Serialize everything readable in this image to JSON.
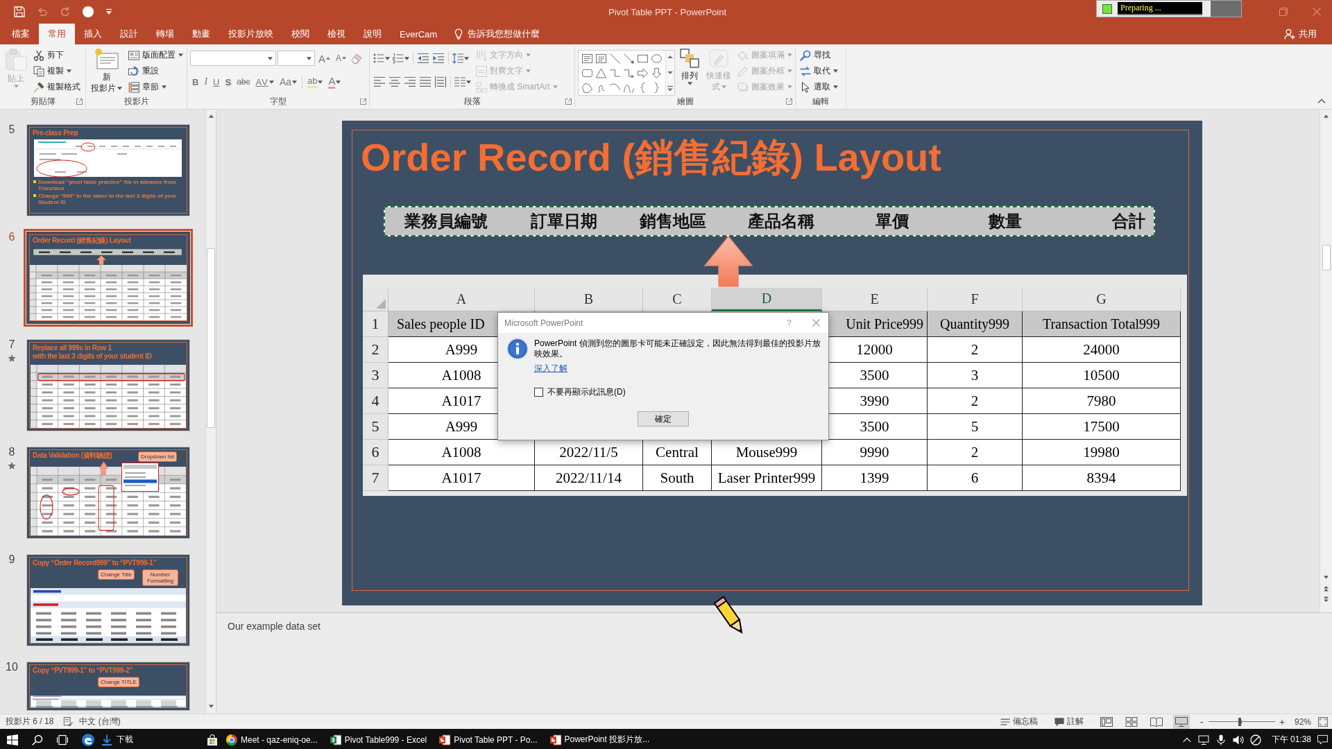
{
  "title_bar": {
    "title": "Pivot Table PPT - PowerPoint",
    "quick_access": [
      {
        "kind": "save",
        "disabled": false
      },
      {
        "kind": "undo",
        "disabled": true
      },
      {
        "kind": "redo",
        "disabled": true
      },
      {
        "kind": "record",
        "disabled": false
      },
      {
        "kind": "customize",
        "disabled": false
      }
    ],
    "recorder_status": "Preparing ..."
  },
  "ribbon_tabs": {
    "tabs": [
      {
        "label": "檔案",
        "selected": false
      },
      {
        "label": "常用",
        "selected": true
      },
      {
        "label": "插入",
        "selected": false
      },
      {
        "label": "設計",
        "selected": false
      },
      {
        "label": "轉場",
        "selected": false
      },
      {
        "label": "動畫",
        "selected": false
      },
      {
        "label": "投影片放映",
        "selected": false
      },
      {
        "label": "校閱",
        "selected": false
      },
      {
        "label": "檢視",
        "selected": false
      },
      {
        "label": "說明",
        "selected": false
      },
      {
        "label": "EverCam",
        "selected": false
      }
    ],
    "tell_me": "告訴我您想做什麼",
    "share": "共用"
  },
  "ribbon": {
    "groups": [
      {
        "kind": "clipboard",
        "label": "剪貼簿",
        "launcher": true,
        "items": [
          {
            "lines": [
              "貼上"
            ],
            "disabled": true
          },
          {
            "label": "剪下",
            "disabled": false
          },
          {
            "label": "複製",
            "disabled": false
          },
          {
            "label": "複製格式",
            "disabled": false
          }
        ]
      },
      {
        "kind": "slides",
        "label": "投影片",
        "launcher": false,
        "items": [
          {
            "lines": [
              "新",
              "投影片"
            ],
            "disabled": false
          },
          {
            "label": "版面配置",
            "disabled": false
          },
          {
            "label": "重設",
            "disabled": false
          },
          {
            "label": "章節",
            "disabled": false
          }
        ]
      },
      {
        "kind": "font",
        "label": "字型",
        "launcher": true,
        "size_glyphs": [
          "A",
          "A"
        ],
        "format_glyphs": [
          "B",
          "I",
          "U",
          "S",
          "abc",
          "AV",
          "Aa"
        ],
        "highlight_glyph": "ab",
        "color_glyph": "A"
      },
      {
        "kind": "paragraph",
        "label": "段落",
        "launcher": true,
        "items": [
          {
            "label": "文字方向",
            "disabled": true
          },
          {
            "label": "對齊文字",
            "disabled": true
          },
          {
            "label": "轉換成 SmartArt",
            "disabled": true
          }
        ]
      },
      {
        "kind": "drawing",
        "label": "繪圖",
        "launcher": true,
        "items": [
          {
            "lines": [
              "排列"
            ],
            "disabled": false
          },
          {
            "lines": [
              "快速樣",
              "式"
            ],
            "disabled": true
          },
          {
            "label": "圖案填滿",
            "disabled": true
          },
          {
            "label": "圖案外框",
            "disabled": true
          },
          {
            "label": "圖案效果",
            "disabled": true
          }
        ]
      },
      {
        "kind": "editing",
        "label": "編輯",
        "launcher": false,
        "items": [
          {
            "label": "尋找",
            "disabled": false
          },
          {
            "label": "取代",
            "disabled": false
          },
          {
            "label": "選取",
            "disabled": false
          }
        ]
      }
    ]
  },
  "slide_panel": {
    "slides": [
      {
        "number": "5",
        "selected": false,
        "animated": false,
        "kind": "screenshot",
        "title_lines": [
          "Pre-class Prep"
        ],
        "bullets": [
          "Download “pivot table practice” file in advance from Tronclass",
          "Change “999” in the name to the last 3 digits of your Student ID"
        ]
      },
      {
        "number": "6",
        "selected": true,
        "animated": false,
        "kind": "layout",
        "title_lines": [
          "Order Record (銷售紀錄) Layout"
        ]
      },
      {
        "number": "7",
        "selected": false,
        "animated": true,
        "kind": "table",
        "title_lines": [
          "Replace all 999s in Row 1",
          "with the last 3 digits of your student ID"
        ]
      },
      {
        "number": "8",
        "selected": false,
        "animated": true,
        "kind": "validation",
        "title_lines": [
          "Data Validation (資料驗證)"
        ],
        "callouts": [
          "Dropdown list"
        ]
      },
      {
        "number": "9",
        "selected": false,
        "animated": false,
        "kind": "pivot",
        "title_lines": [
          "Copy “Order Record999” to “PVT999-1”"
        ],
        "callouts": [
          "Change Title",
          "Number Formatting"
        ]
      },
      {
        "number": "10",
        "selected": false,
        "animated": false,
        "kind": "pivot",
        "title_lines": [
          "Copy “PVT999-1” to “PVT999-2”"
        ],
        "callouts": [
          "Change TITLE"
        ]
      }
    ]
  },
  "slide": {
    "title": "Order Record (銷售紀錄) Layout",
    "header_strip": [
      "業務員編號",
      "訂單日期",
      "銷售地區",
      "產品名稱",
      "單價",
      "數量",
      "合計"
    ],
    "sheet": {
      "columns": [
        {
          "label": "A",
          "selected": false
        },
        {
          "label": "B",
          "selected": false
        },
        {
          "label": "C",
          "selected": false
        },
        {
          "label": "D",
          "selected": true
        },
        {
          "label": "E",
          "selected": false
        },
        {
          "label": "F",
          "selected": false
        },
        {
          "label": "G",
          "selected": false
        }
      ],
      "rows": [
        {
          "number": "1",
          "kind": "header",
          "cells": [
            "Sales people ID",
            null,
            null,
            null,
            "Unit Price999",
            "Quantity999",
            "Transaction Total999"
          ]
        },
        {
          "number": "2",
          "kind": "data",
          "cells": [
            "A999",
            null,
            null,
            null,
            "12000",
            "2",
            "24000"
          ]
        },
        {
          "number": "3",
          "kind": "data",
          "cells": [
            "A1008",
            null,
            null,
            null,
            "3500",
            "3",
            "10500"
          ]
        },
        {
          "number": "4",
          "kind": "data",
          "cells": [
            "A1017",
            null,
            null,
            null,
            "3990",
            "2",
            "7980"
          ]
        },
        {
          "number": "5",
          "kind": "data",
          "cells": [
            "A999",
            null,
            null,
            null,
            "3500",
            "5",
            "17500"
          ]
        },
        {
          "number": "6",
          "kind": "data",
          "cells": [
            "A1008",
            "2022/11/5",
            "Central",
            "Mouse999",
            "9990",
            "2",
            "19980"
          ]
        },
        {
          "number": "7",
          "kind": "data",
          "cells": [
            "A1017",
            "2022/11/14",
            "South",
            "Laser Printer999",
            "1399",
            "6",
            "8394"
          ]
        }
      ]
    }
  },
  "dialog": {
    "title": "Microsoft PowerPoint",
    "help": "?",
    "message": "PowerPoint 偵測到您的圖形卡可能未正確設定，因此無法得到最佳的投影片放映效果。",
    "link": "深入了解",
    "checkbox": {
      "label": "不要再顯示此訊息(D)",
      "checked": false
    },
    "button": "確定"
  },
  "notes": "Our example data set",
  "status_bar": {
    "slide_position": "投影片 6 / 18",
    "language": "中文 (台灣)",
    "notes": "備忘稿",
    "comments": "註解",
    "views": [
      {
        "kind": "normal",
        "selected": false
      },
      {
        "kind": "sorter",
        "selected": false
      },
      {
        "kind": "reading",
        "selected": false
      },
      {
        "kind": "slideshow",
        "selected": true
      }
    ],
    "zoom": {
      "out": "-",
      "in": "+",
      "level": 0.47,
      "percent": "92%"
    }
  },
  "taskbar": {
    "downloads": "下載",
    "apps": [
      {
        "kind": "store"
      },
      {
        "kind": "chrome",
        "label": "Meet - qaz-eniq-oe..."
      },
      {
        "kind": "excel",
        "label": "Pivot Table999 - Excel"
      },
      {
        "kind": "powerpoint",
        "label": "Pivot Table PPT - Po..."
      },
      {
        "kind": "powerpoint",
        "label": "PowerPoint 投影片放..."
      }
    ],
    "clock": "下午 01:38"
  }
}
